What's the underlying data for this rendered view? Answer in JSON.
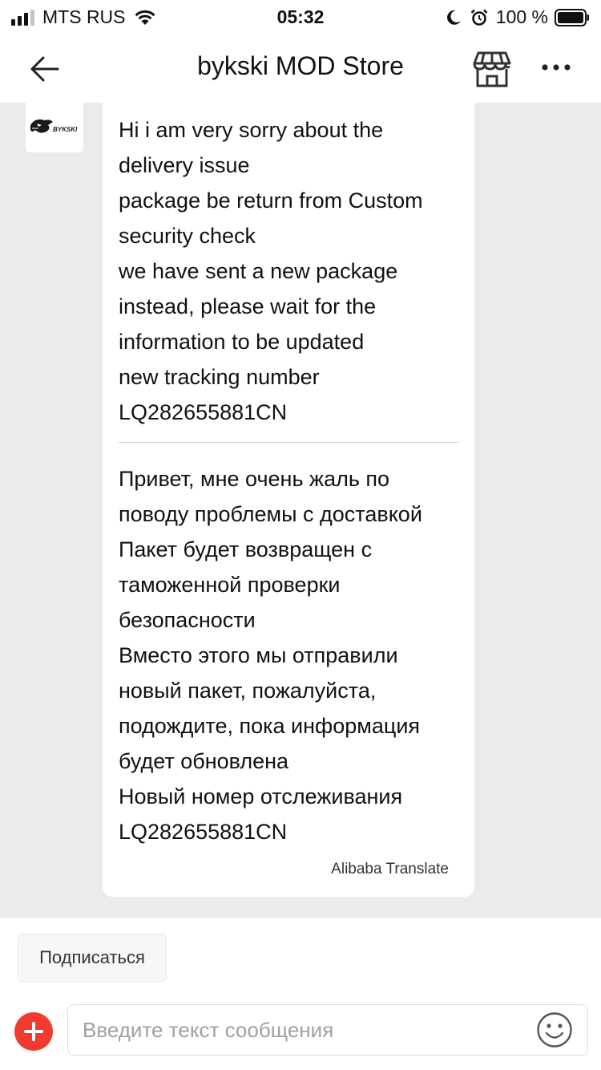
{
  "status_bar": {
    "carrier": "MTS RUS",
    "time": "05:32",
    "battery": "100 %",
    "icons": [
      "signal-icon",
      "wifi-icon",
      "moon-icon",
      "alarm-icon",
      "battery-icon"
    ]
  },
  "nav": {
    "title": "bykski MOD Store",
    "icons": [
      "back-arrow-icon",
      "store-icon",
      "more-icon"
    ]
  },
  "chat": {
    "avatar_text": "BYKSKI",
    "message_original": [
      "Hi i am very sorry about the",
      "delivery issue",
      "package be return from Custom",
      "security check",
      "we have sent a new package",
      "instead, please wait for the",
      "information to be updated",
      "new tracking number",
      "LQ282655881CN"
    ],
    "message_translated": [
      "Привет, мне очень жаль по",
      "поводу проблемы с доставкой",
      "Пакет будет возвращен с",
      "таможенной проверки",
      "безопасности",
      "Вместо этого мы отправили",
      "новый пакет, пожалуйста,",
      "подождите, пока информация",
      "будет обновлена",
      "Новый номер отслеживания",
      "LQ282655881CN"
    ],
    "translate_credit": "Alibaba Translate"
  },
  "bottom": {
    "subscribe_label": "Подписаться",
    "input_placeholder": "Введите текст сообщения",
    "input_value": "",
    "icons": [
      "add-icon",
      "emoji-icon"
    ]
  },
  "colors": {
    "accent_red": "#f23b2f",
    "chat_background": "#ebebeb",
    "bubble_background": "#ffffff"
  }
}
